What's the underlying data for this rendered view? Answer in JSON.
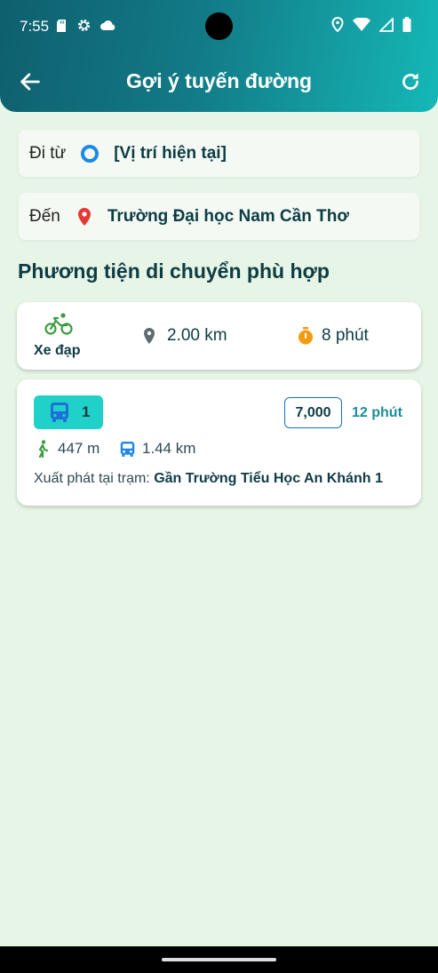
{
  "status_bar": {
    "time": "7:55"
  },
  "app_bar": {
    "title": "Gợi ý tuyến đường"
  },
  "from": {
    "label": "Đi từ",
    "value": "[Vị trí hiện tại]"
  },
  "to": {
    "label": "Đến",
    "value": "Trường Đại học Nam Cần Thơ"
  },
  "section_title": "Phương tiện di chuyển phù hợp",
  "bike_option": {
    "mode_label": "Xe đạp",
    "distance": "2.00 km",
    "duration": "8 phút"
  },
  "bus_option": {
    "route_number": "1",
    "price": "7,000",
    "duration": "12 phút",
    "walk_distance": "447 m",
    "bus_distance": "1.44 km",
    "start_prefix": "Xuất phát tại trạm: ",
    "start_station": "Gần Trường Tiểu Học An Khánh 1"
  },
  "colors": {
    "header_start": "#0f5f6e",
    "header_end": "#15b8b7",
    "background": "#e7f5e6",
    "accent_teal": "#1fd1c8",
    "green": "#3a9d3f",
    "orange": "#f39b0f",
    "blue": "#1e88e5"
  },
  "icons": [
    "back-arrow-icon",
    "refresh-icon",
    "origin-circle-icon",
    "location-pin-icon",
    "bicycle-icon",
    "timer-icon",
    "bus-icon",
    "walk-icon"
  ]
}
